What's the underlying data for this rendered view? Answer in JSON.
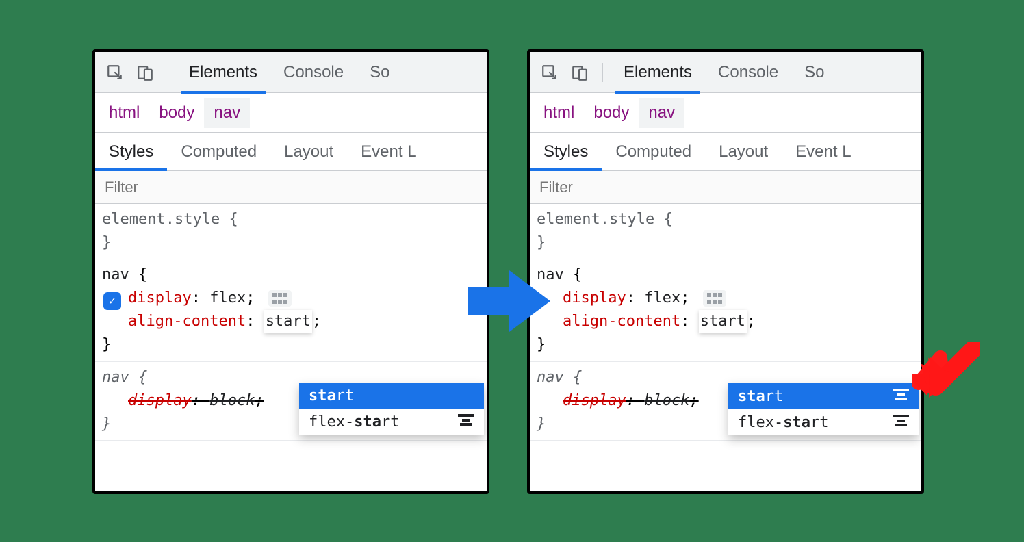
{
  "toolbar": {
    "tabs": [
      "Elements",
      "Console",
      "So"
    ],
    "active": "Elements"
  },
  "breadcrumb": {
    "items": [
      "html",
      "body",
      "nav"
    ],
    "active": "nav"
  },
  "subtabs": {
    "items": [
      "Styles",
      "Computed",
      "Layout",
      "Event L"
    ],
    "active": "Styles"
  },
  "filter": {
    "placeholder": "Filter"
  },
  "rules": {
    "element_style": {
      "selector": "element.style",
      "open": "{",
      "close": "}"
    },
    "nav": {
      "selector": "nav",
      "open": "{",
      "close": "}",
      "props": {
        "display": {
          "name": "display",
          "value": "flex",
          "sep": ": ",
          "end": ";"
        },
        "align_content": {
          "name": "align-content",
          "value": "start",
          "sep": ": ",
          "end": ";"
        }
      }
    },
    "nav2": {
      "selector": "nav",
      "open": "{",
      "close": "}",
      "props": {
        "display": {
          "name": "display",
          "value": "block",
          "sep": ": ",
          "end": ";"
        }
      }
    }
  },
  "autocomplete_left": {
    "items": [
      {
        "prefix": "sta",
        "rest": "rt",
        "selected": true,
        "has_preview": false
      },
      {
        "full_prefix": "flex-",
        "bold": "sta",
        "rest": "rt",
        "selected": false,
        "has_preview": true,
        "preview": "flex-start"
      }
    ]
  },
  "autocomplete_right": {
    "items": [
      {
        "prefix": "sta",
        "rest": "rt",
        "selected": true,
        "has_preview": true,
        "preview": "start"
      },
      {
        "full_prefix": "flex-",
        "bold": "sta",
        "rest": "rt",
        "selected": false,
        "has_preview": true,
        "preview": "flex-start"
      }
    ]
  }
}
